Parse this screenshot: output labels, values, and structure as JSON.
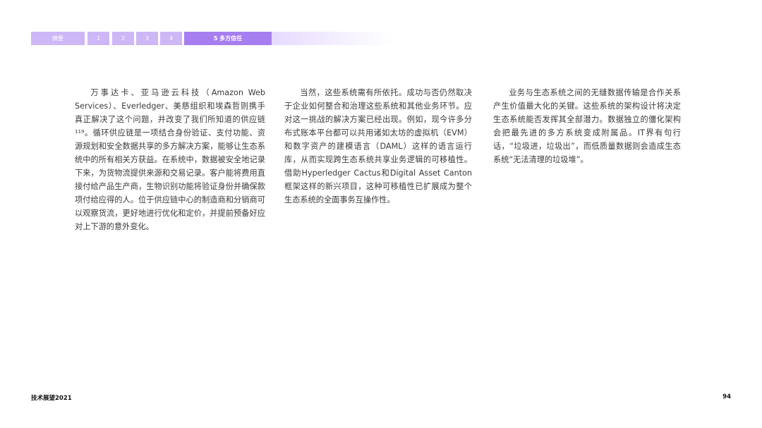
{
  "nav": {
    "items": [
      "摘要",
      "1",
      "2",
      "3",
      "4",
      "5 多方信任"
    ],
    "active_index": 5,
    "colors": {
      "inactive": "#cdb7f6",
      "active": "#a77ef0"
    }
  },
  "columns": [
    "万事达卡、亚马逊云科技（Amazon Web Services）、Everledger、美慈组织和埃森哲则携手真正解决了这个问题，并改变了我们所知道的供应链¹¹⁹。循环供应链是一项结合身份验证、支付功能、资源规划和安全数据共享的多方解决方案，能够让生态系统中的所有相关方获益。在系统中，数据被安全地记录下来，为货物流提供来源和交易记录。客户能将费用直接付给产品生产商，生物识别功能将验证身份并确保款项付给应得的人。位于供应链中心的制造商和分销商可以观察货流，更好地进行优化和定价，并提前预备好应对上下游的意外变化。",
    "当然，这些系统需有所依托。成功与否仍然取决于企业如何整合和治理这些系统和其他业务环节。应对这一挑战的解决方案已经出现。例如，现今许多分布式账本平台都可以共用诸如太坊的虚拟机（EVM）和数字资产的建模语言（DAML）这样的语言运行库，从而实现跨生态系统共享业务逻辑的可移植性。借助Hyperledger Cactus和Digital Asset Canton框架这样的新兴项目，这种可移植性已扩展成为整个生态系统的全面事务互操作性。",
    "业务与生态系统之间的无缝数据传输是合作关系产生价值最大化的关键。这些系统的架构设计将决定生态系统能否发挥其全部潜力。数据独立的僵化架构会把最先进的多方系统变成附属品。IT界有句行话，“垃圾进，垃圾出”，而低质量数据则会造成生态系统“无法清理的垃圾堆”。"
  ],
  "footer": {
    "left": "技术展望2021",
    "right": "94"
  }
}
